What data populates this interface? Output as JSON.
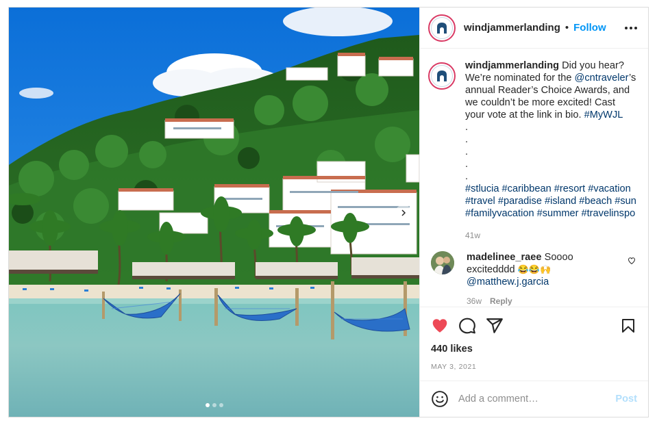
{
  "post": {
    "account": {
      "username": "windjammerlanding",
      "separator": "•",
      "follow_label": "Follow",
      "more_icon": "more-horizontal-icon"
    },
    "caption": {
      "username": "windjammerlanding",
      "text_part1": " Did you hear? We’re nominated for the ",
      "mention": "@cntraveler",
      "text_part2": "’s annual Reader’s Choice Awards, and we couldn’t be more excited! Cast your vote at the link in bio. ",
      "tag_mywjl": "#MyWJL",
      "dots": [
        ".",
        ".",
        ".",
        ".",
        "."
      ],
      "hashtags": "#stlucia #caribbean #resort #vacation #travel #paradise #island #beach #sun #familyvacation #summer #travelinspo",
      "time": "41w"
    },
    "comments": [
      {
        "username": "madelinee_raee",
        "text": " Soooo excitedddd ",
        "emojis": "😂😂🙌",
        "mention": "@matthew.j.garcia",
        "time": "36w",
        "reply_label": "Reply"
      }
    ],
    "likes": "440 likes",
    "date": "MAY 3, 2021",
    "add_comment": {
      "placeholder": "Add a comment…",
      "post_label": "Post"
    },
    "carousel": {
      "slides": 3,
      "active": 0
    },
    "colors": {
      "accent": "#0095f6",
      "liked_heart": "#ed4956",
      "hashtag": "#00376b",
      "muted": "#8e8e8e"
    }
  }
}
